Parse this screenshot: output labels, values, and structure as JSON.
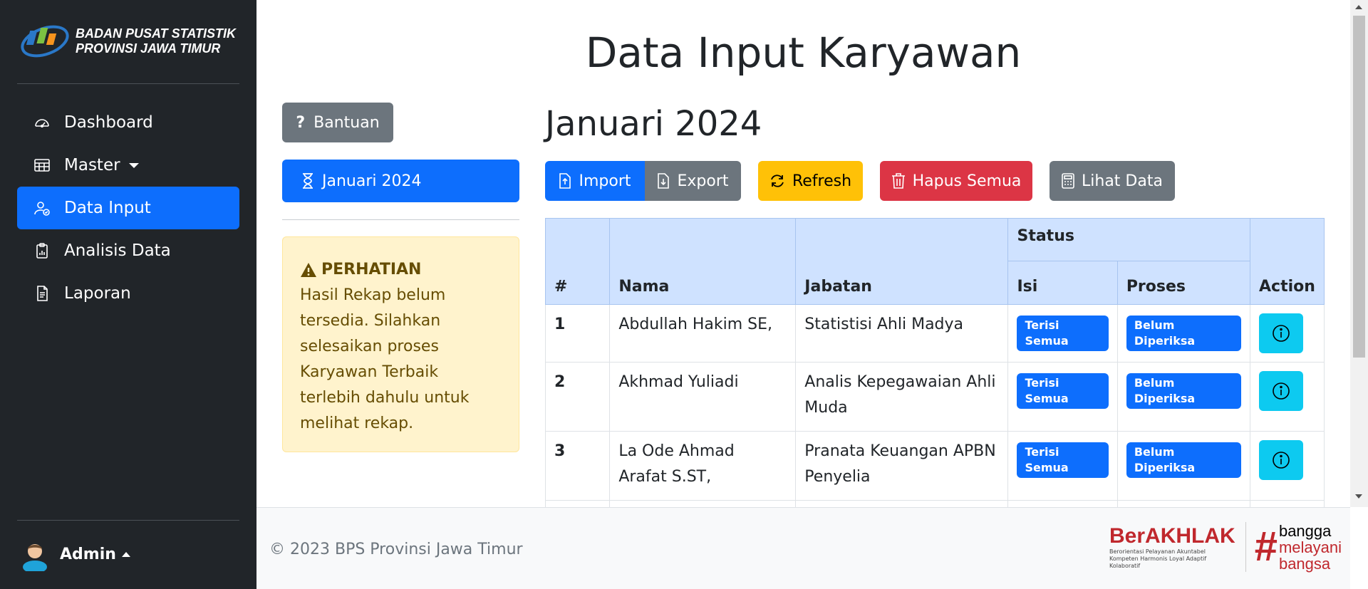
{
  "brand": {
    "line1": "BADAN PUSAT STATISTIK",
    "line2": "PROVINSI JAWA TIMUR"
  },
  "sidebar": {
    "items": [
      {
        "label": "Dashboard",
        "icon": "speedometer-icon"
      },
      {
        "label": "Master",
        "icon": "table-icon"
      },
      {
        "label": "Data Input",
        "icon": "person-check-icon",
        "active": true
      },
      {
        "label": "Analisis Data",
        "icon": "clipboard-data-icon"
      },
      {
        "label": "Laporan",
        "icon": "file-text-icon"
      }
    ],
    "user": "Admin"
  },
  "header": {
    "title": "Data Input Karyawan"
  },
  "left": {
    "help_label": "Bantuan",
    "period_label": "Januari 2024",
    "alert_title": "PERHATIAN",
    "alert_text": "Hasil Rekap belum tersedia. Silahkan selesaikan proses Karyawan Terbaik terlebih dahulu untuk melihat rekap."
  },
  "content": {
    "period_title": "Januari 2024",
    "toolbar": {
      "import": "Import",
      "export": "Export",
      "refresh": "Refresh",
      "delete_all": "Hapus Semua",
      "view_data": "Lihat Data"
    },
    "table": {
      "headers": {
        "no": "#",
        "name": "Nama",
        "position": "Jabatan",
        "status": "Status",
        "filled": "Isi",
        "process": "Proses",
        "action": "Action"
      },
      "rows": [
        {
          "no": "1",
          "name": "Abdullah Hakim SE,",
          "position": "Statistisi Ahli Madya",
          "filled": "Terisi Semua",
          "process": "Belum Diperiksa"
        },
        {
          "no": "2",
          "name": "Akhmad Yuliadi",
          "position": "Analis Kepegawaian Ahli Muda",
          "filled": "Terisi Semua",
          "process": "Belum Diperiksa"
        },
        {
          "no": "3",
          "name": "La Ode Ahmad Arafat S.ST,",
          "position": "Pranata Keuangan APBN Penyelia",
          "filled": "Terisi Semua",
          "process": "Belum Diperiksa"
        },
        {
          "no": "",
          "name": "",
          "position": "",
          "filled": "",
          "process": ""
        }
      ]
    }
  },
  "footer": {
    "copyright": "© 2023 BPS Provinsi Jawa Timur",
    "berakhlak": "BerAKHLAK",
    "berakhlak_sub": "Berorientasi Pelayanan Akuntabel Kompeten Harmonis Loyal Adaptif Kolaboratif",
    "bangga": [
      "bangga",
      "melayani",
      "bangsa"
    ]
  },
  "colors": {
    "primary": "#0d6efd",
    "secondary": "#6c757d",
    "warning": "#ffc107",
    "danger": "#dc3545",
    "info": "#0dcaf0",
    "sidebar": "#212529"
  }
}
